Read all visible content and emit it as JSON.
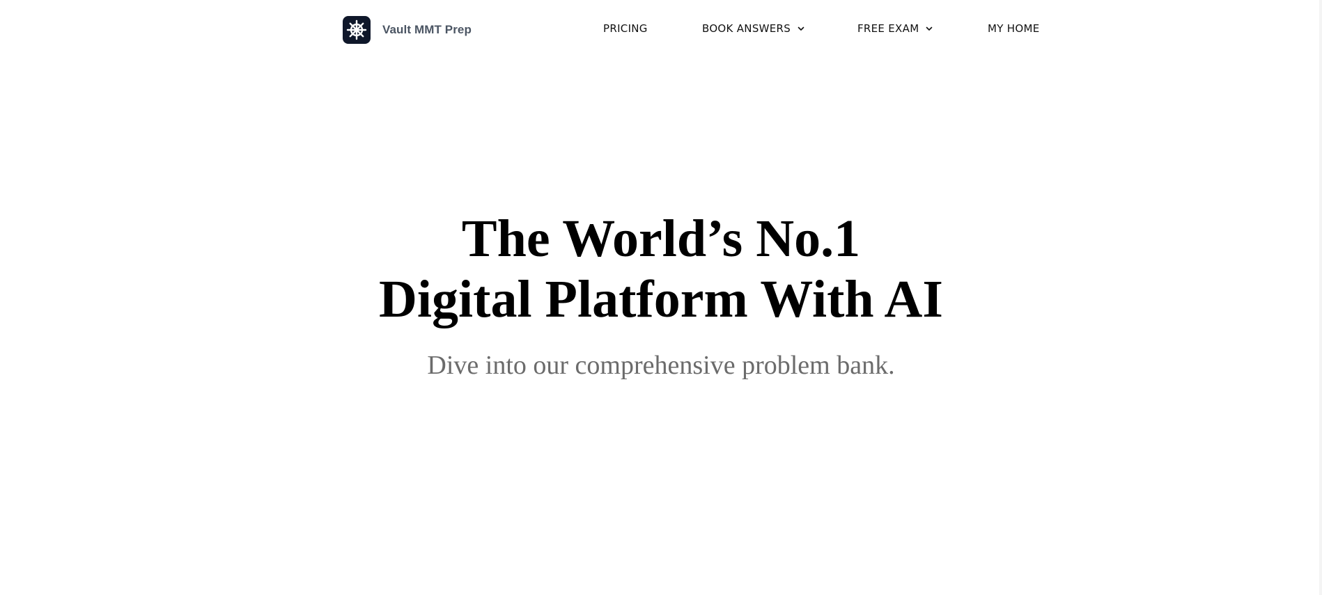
{
  "brand": {
    "name": "Vault MMT Prep",
    "logo_icon": "ship-wheel-icon",
    "logo_bg": "#0f172a"
  },
  "nav": {
    "pricing": "PRICING",
    "book_answers": "BOOK ANSWERS",
    "free_exam": "FREE EXAM",
    "my_home": "MY HOME",
    "dropdown_icon": "chevron-down-icon"
  },
  "hero": {
    "title_line1": "The World’s No.1",
    "title_line2": "Digital Platform With AI",
    "subtitle": "Dive into our comprehensive problem bank."
  }
}
